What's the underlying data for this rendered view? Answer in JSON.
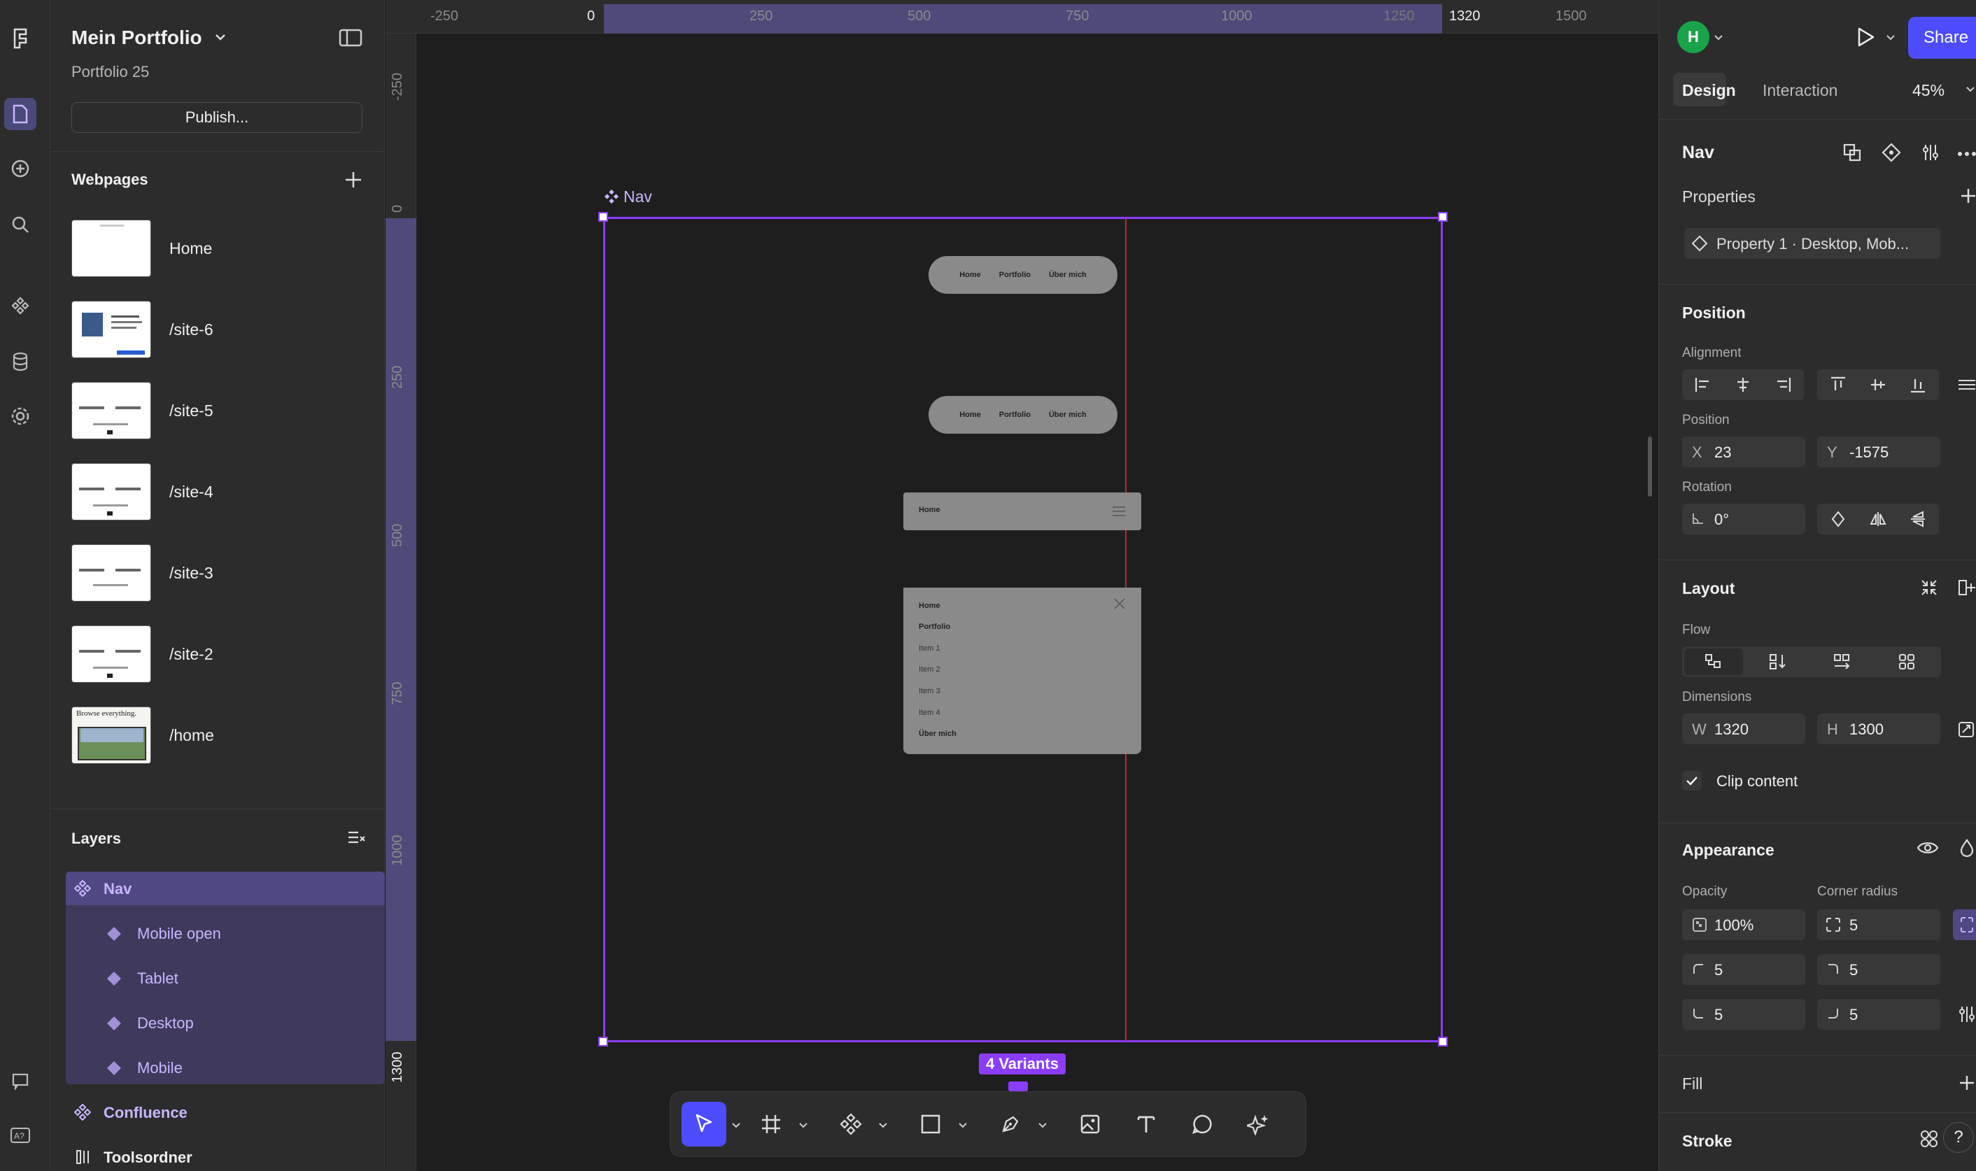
{
  "project": {
    "title": "Mein Portfolio",
    "subtitle": "Portfolio 25",
    "publish_label": "Publish..."
  },
  "webpages": {
    "label": "Webpages",
    "items": [
      {
        "label": "Home"
      },
      {
        "label": "/site-6"
      },
      {
        "label": "/site-5"
      },
      {
        "label": "/site-4"
      },
      {
        "label": "/site-3"
      },
      {
        "label": "/site-2"
      },
      {
        "label": "/home",
        "thumb_text": "Browse everything."
      }
    ]
  },
  "layers": {
    "label": "Layers",
    "items": [
      {
        "label": "Nav"
      },
      {
        "label": "Mobile open"
      },
      {
        "label": "Tablet"
      },
      {
        "label": "Desktop"
      },
      {
        "label": "Mobile"
      },
      {
        "label": "Confluence"
      },
      {
        "label": "Toolsordner"
      }
    ]
  },
  "canvas": {
    "ruler_x": [
      "-250",
      "0",
      "250",
      "500",
      "750",
      "1000",
      "1250",
      "1320",
      "1500"
    ],
    "ruler_y": [
      "-250",
      "0",
      "250",
      "500",
      "750",
      "1000",
      "1300"
    ],
    "frame_label": "Nav",
    "variants_badge": "4 Variants",
    "nav_links": [
      "Home",
      "Portfolio",
      "Über mich"
    ],
    "tablet_label": "Home",
    "mobile_menu": [
      "Home",
      "Portfolio",
      "Item 1",
      "Item 2",
      "Item 3",
      "Item 4",
      "Über mich"
    ]
  },
  "right": {
    "avatar_initial": "H",
    "share_label": "Share",
    "tabs": [
      "Design",
      "Interaction"
    ],
    "zoom": "45%",
    "component_name": "Nav",
    "properties_label": "Properties",
    "property_chip": "Property 1 · Desktop, Mob...",
    "position_section": "Position",
    "alignment_label": "Alignment",
    "position_label": "Position",
    "x_prefix": "X",
    "x_value": "23",
    "y_prefix": "Y",
    "y_value": "-1575",
    "rotation_label": "Rotation",
    "rotation_value": "0°",
    "layout_section": "Layout",
    "flow_label": "Flow",
    "dimensions_label": "Dimensions",
    "w_prefix": "W",
    "w_value": "1320",
    "h_prefix": "H",
    "h_value": "1300",
    "clip_label": "Clip content",
    "appearance_section": "Appearance",
    "opacity_label": "Opacity",
    "opacity_value": "100%",
    "corner_label": "Corner radius",
    "corner_value": "5",
    "corner_tl": "5",
    "corner_tr": "5",
    "corner_bl": "5",
    "corner_br": "5",
    "fill_section": "Fill",
    "stroke_section": "Stroke",
    "help_label": "?"
  },
  "colors": {
    "accent": "#8b3dff",
    "active_tool": "#4d4dff",
    "share": "#4d4dff",
    "avatar": "#1aa34a"
  }
}
